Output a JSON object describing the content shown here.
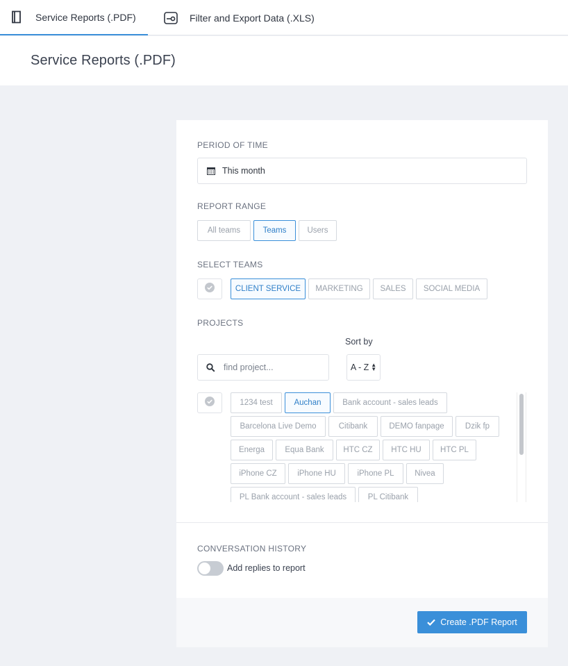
{
  "tabs": [
    {
      "label": "Service Reports (.PDF)",
      "icon": "document-icon",
      "active": true
    },
    {
      "label": "Filter and Export Data (.XLS)",
      "icon": "filter-export-icon",
      "active": false
    }
  ],
  "page": {
    "title": "Service Reports (.PDF)"
  },
  "period": {
    "label": "PERIOD OF TIME",
    "value": "This month",
    "icon": "calendar-icon"
  },
  "report_range": {
    "label": "REPORT RANGE",
    "options": [
      "All teams",
      "Teams",
      "Users"
    ],
    "selected": "Teams"
  },
  "teams": {
    "label": "SELECT TEAMS",
    "options": [
      "CLIENT SERVICE",
      "MARKETING",
      "SALES",
      "SOCIAL MEDIA"
    ],
    "selected": "CLIENT SERVICE"
  },
  "projects": {
    "label": "PROJECTS",
    "sort_label": "Sort by",
    "sort_value": "A - Z",
    "search_placeholder": "find project...",
    "items": [
      "1234 test",
      "Auchan",
      "Bank account - sales leads",
      "Barcelona Live Demo",
      "Citibank",
      "DEMO fanpage",
      "Dzik fp",
      "Energa",
      "Equa Bank",
      "HTC CZ",
      "HTC HU",
      "HTC PL",
      "iPhone CZ",
      "iPhone HU",
      "iPhone PL",
      "Nivea",
      "PL Bank account - sales leads",
      "PL Citibank"
    ],
    "selected": "Auchan"
  },
  "history": {
    "label": "CONVERSATION HISTORY",
    "toggle_label": "Add replies to report",
    "enabled": false
  },
  "footer": {
    "create_label": "Create .PDF Report",
    "icon": "check-icon"
  },
  "colors": {
    "accent": "#3a8fd9",
    "background": "#eff1f5"
  }
}
